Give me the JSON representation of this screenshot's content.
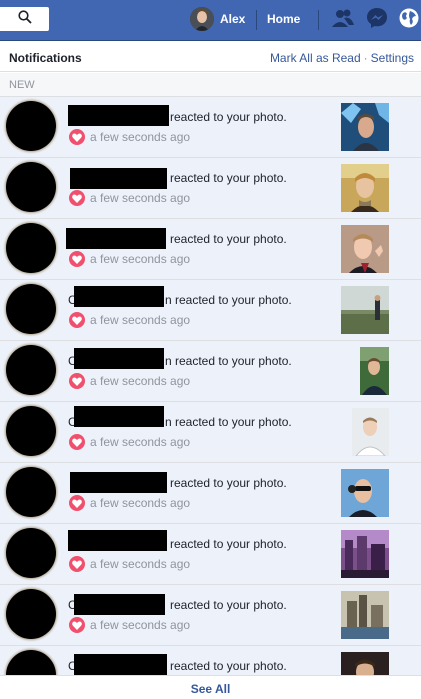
{
  "topbar": {
    "user_name": "Alex",
    "home_label": "Home",
    "icons": [
      "search-icon",
      "friends-icon",
      "messenger-icon",
      "globe-notifications-icon"
    ],
    "color": "#4267b2"
  },
  "header": {
    "title": "Notifications",
    "mark_all_read": "Mark All as Read",
    "separator": "·",
    "settings": "Settings"
  },
  "section": {
    "label": "NEW"
  },
  "notifications": [
    {
      "prefix": "",
      "text": "reacted to your photo.",
      "time": "a few seconds ago",
      "reaction": "heart-icon",
      "thumb": "photo-1"
    },
    {
      "prefix": "",
      "text": "reacted to your photo.",
      "time": "a few seconds ago",
      "reaction": "heart-icon",
      "thumb": "photo-2"
    },
    {
      "prefix": "",
      "text": "reacted to your photo.",
      "time": "a few seconds ago",
      "reaction": "heart-icon",
      "thumb": "photo-3"
    },
    {
      "prefix": "C",
      "text": "n reacted to your photo.",
      "time": "a few seconds ago",
      "reaction": "heart-icon",
      "thumb": "photo-4"
    },
    {
      "prefix": "C",
      "text": "n reacted to your photo.",
      "time": "a few seconds ago",
      "reaction": "heart-icon",
      "thumb": "photo-5"
    },
    {
      "prefix": "C",
      "text": "n reacted to your photo.",
      "time": "a few seconds ago",
      "reaction": "heart-icon",
      "thumb": "photo-6"
    },
    {
      "prefix": "",
      "text": "reacted to your photo.",
      "time": "a few seconds ago",
      "reaction": "heart-icon",
      "thumb": "photo-7"
    },
    {
      "prefix": "",
      "text": "reacted to your photo.",
      "time": "a few seconds ago",
      "reaction": "heart-icon",
      "thumb": "photo-8"
    },
    {
      "prefix": "C",
      "text": "reacted to your photo.",
      "time": "a few seconds ago",
      "reaction": "heart-icon",
      "thumb": "photo-9"
    },
    {
      "prefix": "C",
      "text": "reacted to your photo.",
      "time": "",
      "reaction": "",
      "thumb": "photo-10"
    }
  ],
  "footer": {
    "see_all": "See All"
  }
}
